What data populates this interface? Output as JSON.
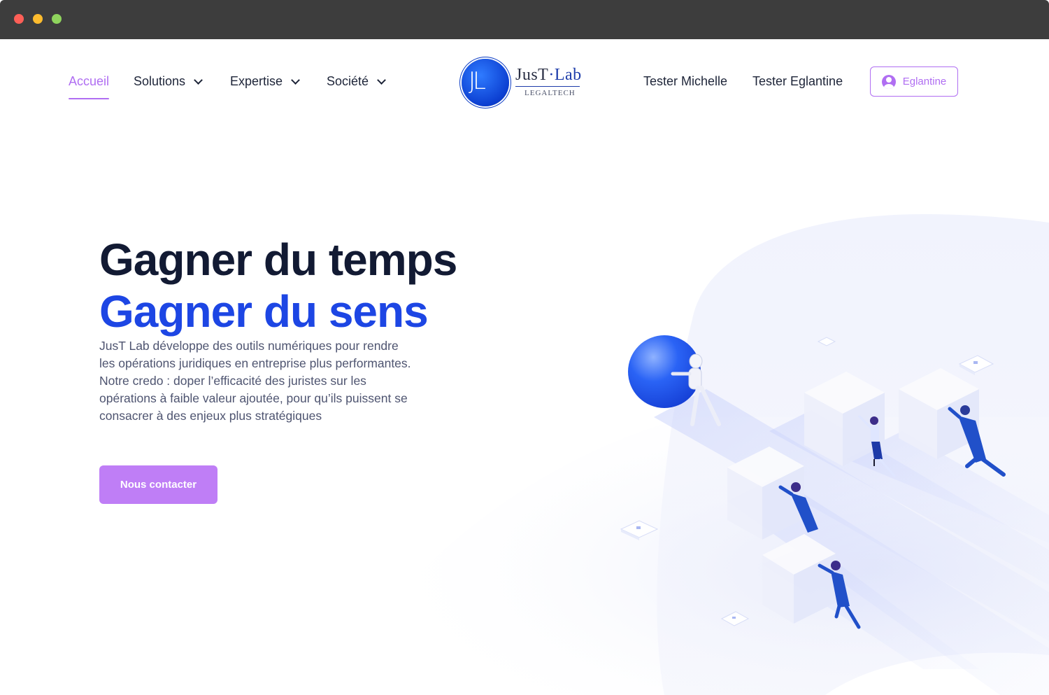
{
  "window": {
    "controls": [
      "close",
      "minimize",
      "maximize"
    ]
  },
  "nav": {
    "items": [
      {
        "label": "Accueil",
        "active": true,
        "dropdown": false
      },
      {
        "label": "Solutions",
        "active": false,
        "dropdown": true
      },
      {
        "label": "Expertise",
        "active": false,
        "dropdown": true
      },
      {
        "label": "Société",
        "active": false,
        "dropdown": true
      }
    ],
    "logo": {
      "initials": "JL",
      "name_part1": "JusT",
      "separator": "·",
      "name_part2": "Lab",
      "subtitle": "LEGALTECH"
    },
    "links": [
      {
        "label": "Tester Michelle"
      },
      {
        "label": "Tester Eglantine"
      }
    ],
    "user_button": {
      "label": "Eglantine",
      "icon": "user-circle-icon"
    }
  },
  "hero": {
    "title_line1": "Gagner du temps",
    "title_line2": "Gagner du sens",
    "description_lines": [
      "JusT Lab développe des outils numériques pour rendre",
      "les opérations juridiques en entreprise plus performantes.",
      "Notre credo : doper l’efficacité des juristes sur les",
      "opérations à faible valeur ajoutée, pour qu’ils puissent se",
      "consacrer à des enjeux plus stratégiques"
    ],
    "cta_label": "Nous contacter"
  },
  "colors": {
    "accent": "#b06ef2",
    "button": "#bf7ef6",
    "title_dark": "#121a33",
    "title_blue": "#1d46e4",
    "body_text": "#4e5470"
  }
}
